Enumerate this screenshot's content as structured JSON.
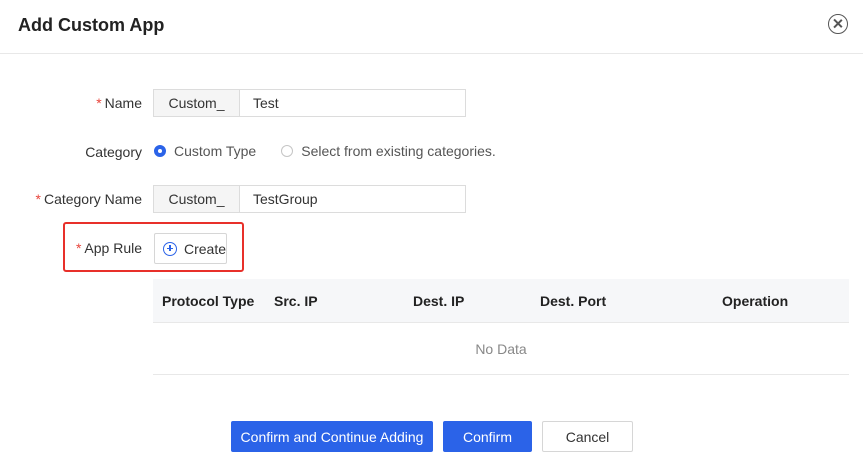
{
  "dialog": {
    "title": "Add Custom App",
    "close_icon": "close-circle-icon"
  },
  "form": {
    "name": {
      "label": "Name",
      "required": "*",
      "prefix": "Custom_",
      "value": "Test"
    },
    "category": {
      "label": "Category",
      "options": [
        {
          "label": "Custom Type",
          "checked": true
        },
        {
          "label": "Select from existing categories.",
          "checked": false
        }
      ]
    },
    "category_name": {
      "label": "Category Name",
      "required": "*",
      "prefix": "Custom_",
      "value": "TestGroup"
    },
    "app_rule": {
      "label": "App Rule",
      "required": "*",
      "create_label": "Create",
      "create_icon": "plus-circle-icon"
    }
  },
  "table": {
    "columns": [
      "Protocol Type",
      "Src. IP",
      "Dest. IP",
      "Dest. Port",
      "Operation"
    ],
    "empty_text": "No Data"
  },
  "footer": {
    "confirm_continue_label": "Confirm and Continue Adding",
    "confirm_label": "Confirm",
    "cancel_label": "Cancel"
  },
  "colors": {
    "primary": "#2b63e8",
    "highlight": "#e8302a",
    "required": "#e8453c"
  }
}
